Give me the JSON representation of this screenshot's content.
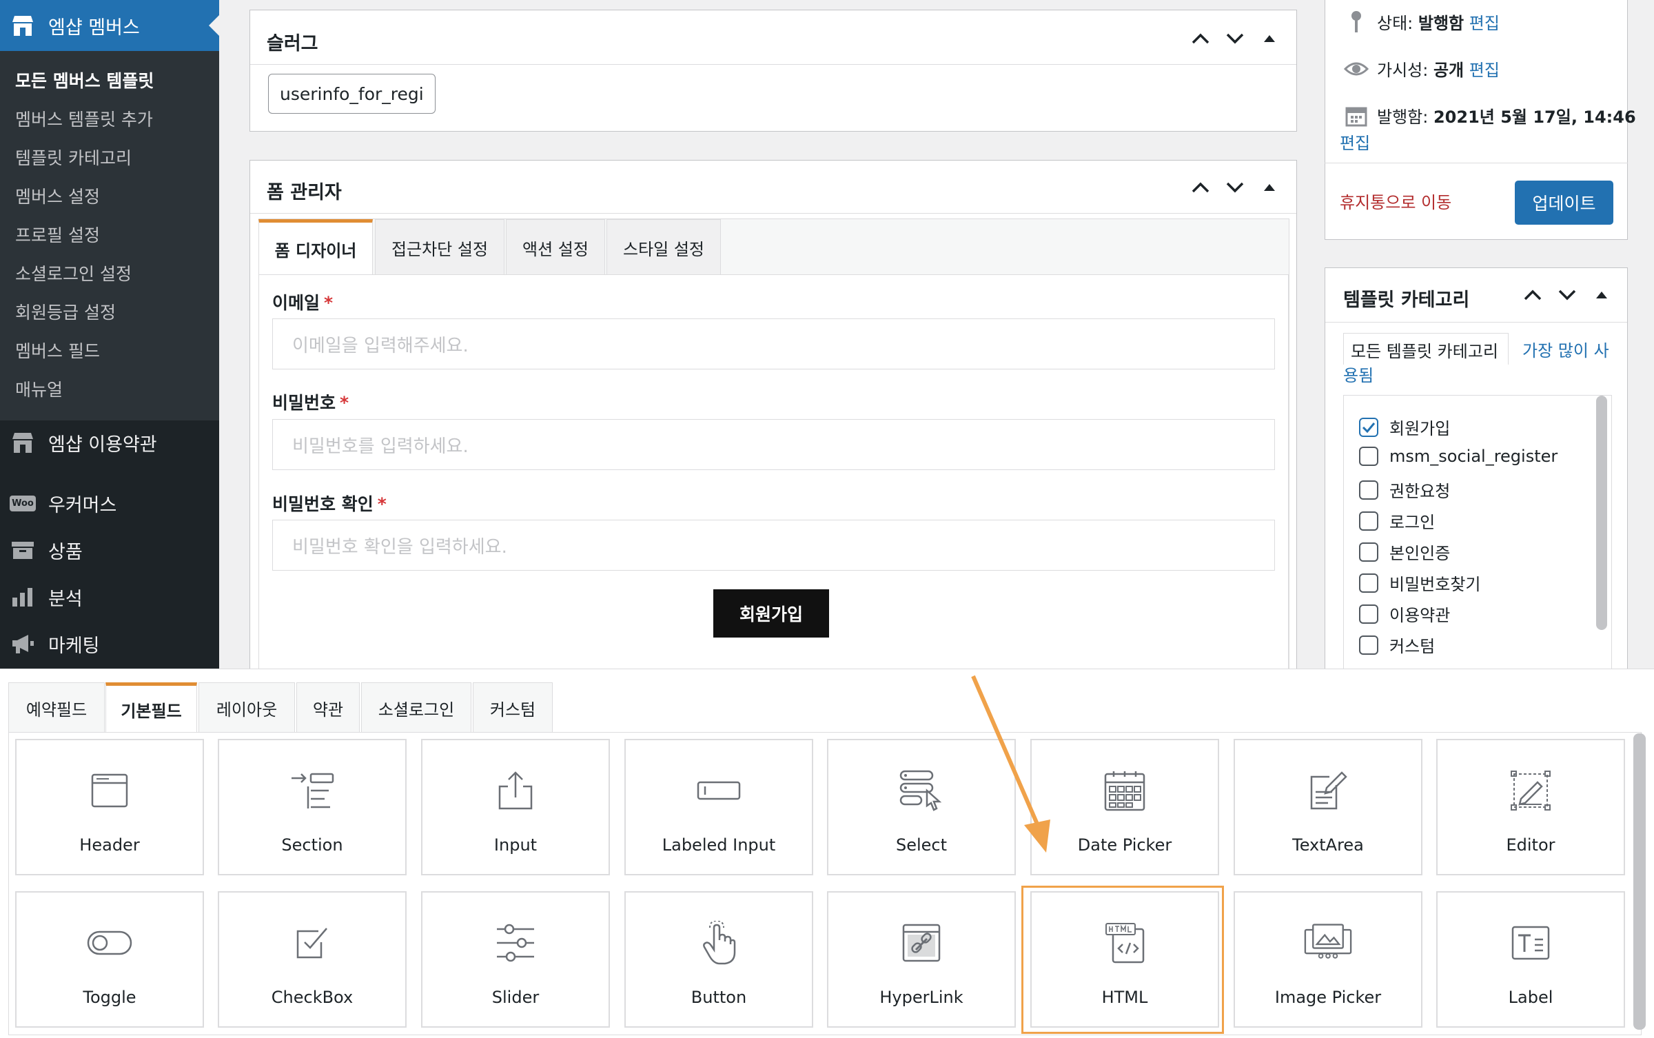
{
  "sidebar": {
    "current_menu": "엠샵 멤버스",
    "submenu": [
      "모든 멤버스 템플릿",
      "멤버스 템플릿 추가",
      "템플릿 카테고리",
      "멤버스 설정",
      "프로필 설정",
      "소셜로그인 설정",
      "회원등급 설정",
      "멤버스 필드",
      "매뉴얼"
    ],
    "menu": [
      {
        "label": "엠샵 이용약관",
        "icon": "shop-icon"
      },
      {
        "label": "우커머스",
        "icon": "woo-icon"
      },
      {
        "label": "상품",
        "icon": "archive-icon"
      },
      {
        "label": "분석",
        "icon": "bar-chart-icon"
      },
      {
        "label": "마케팅",
        "icon": "megaphone-icon"
      }
    ],
    "woo_badge": "Woo"
  },
  "slug_panel": {
    "title": "슬러그",
    "value": "userinfo_for_regi"
  },
  "form_panel": {
    "title": "폼 관리자",
    "tabs": [
      "폼 디자이너",
      "접근차단 설정",
      "액션 설정",
      "스타일 설정"
    ],
    "fields": [
      {
        "label": "이메일",
        "required": "*",
        "placeholder": "이메일을 입력해주세요."
      },
      {
        "label": "비밀번호",
        "required": "*",
        "placeholder": "비밀번호를 입력하세요."
      },
      {
        "label": "비밀번호 확인",
        "required": "*",
        "placeholder": "비밀번호 확인을 입력하세요."
      }
    ],
    "submit": "회원가입"
  },
  "publish": {
    "status_label": "상태:",
    "status_value": "발행함",
    "visibility_label": "가시성:",
    "visibility_value": "공개",
    "published_label": "발행함:",
    "published_value": "2021년 5월 17일, 14:46",
    "edit": "편집",
    "trash": "휴지통으로 이동",
    "update": "업데이트"
  },
  "category_panel": {
    "title": "템플릿 카테고리",
    "tab_all": "모든 템플릿 카테고리",
    "tab_popular_line1": "가장 많이 사",
    "tab_popular_line2": "용됨",
    "items": [
      {
        "label": "회원가입",
        "checked": true
      },
      {
        "label": "msm_social_register",
        "checked": false
      },
      {
        "label": "권한요청",
        "checked": false
      },
      {
        "label": "로그인",
        "checked": false
      },
      {
        "label": "본인인증",
        "checked": false
      },
      {
        "label": "비밀번호찾기",
        "checked": false
      },
      {
        "label": "이용약관",
        "checked": false
      },
      {
        "label": "커스텀",
        "checked": false
      }
    ]
  },
  "builder": {
    "tabs": [
      "예약필드",
      "기본필드",
      "레이아웃",
      "약관",
      "소셜로그인",
      "커스텀"
    ],
    "active_tab": "기본필드",
    "tiles": [
      {
        "label": "Header",
        "icon": "header-icon"
      },
      {
        "label": "Section",
        "icon": "section-icon"
      },
      {
        "label": "Input",
        "icon": "input-icon"
      },
      {
        "label": "Labeled Input",
        "icon": "labeled-input-icon"
      },
      {
        "label": "Select",
        "icon": "select-icon"
      },
      {
        "label": "Date Picker",
        "icon": "calendar-icon"
      },
      {
        "label": "TextArea",
        "icon": "textarea-icon"
      },
      {
        "label": "Editor",
        "icon": "editor-icon"
      },
      {
        "label": "Toggle",
        "icon": "toggle-icon"
      },
      {
        "label": "CheckBox",
        "icon": "checkbox-icon"
      },
      {
        "label": "Slider",
        "icon": "slider-icon"
      },
      {
        "label": "Button",
        "icon": "pointer-icon"
      },
      {
        "label": "HyperLink",
        "icon": "link-icon"
      },
      {
        "label": "HTML",
        "icon": "html-icon"
      },
      {
        "label": "Image Picker",
        "icon": "image-icon"
      },
      {
        "label": "Label",
        "icon": "label-icon"
      }
    ],
    "highlighted": "HTML",
    "arrow_color": "#f0a24a"
  },
  "colors": {
    "accent": "#2271b1",
    "sidebar": "#1d2327",
    "required": "#d63638",
    "highlight": "#f0a24a"
  }
}
